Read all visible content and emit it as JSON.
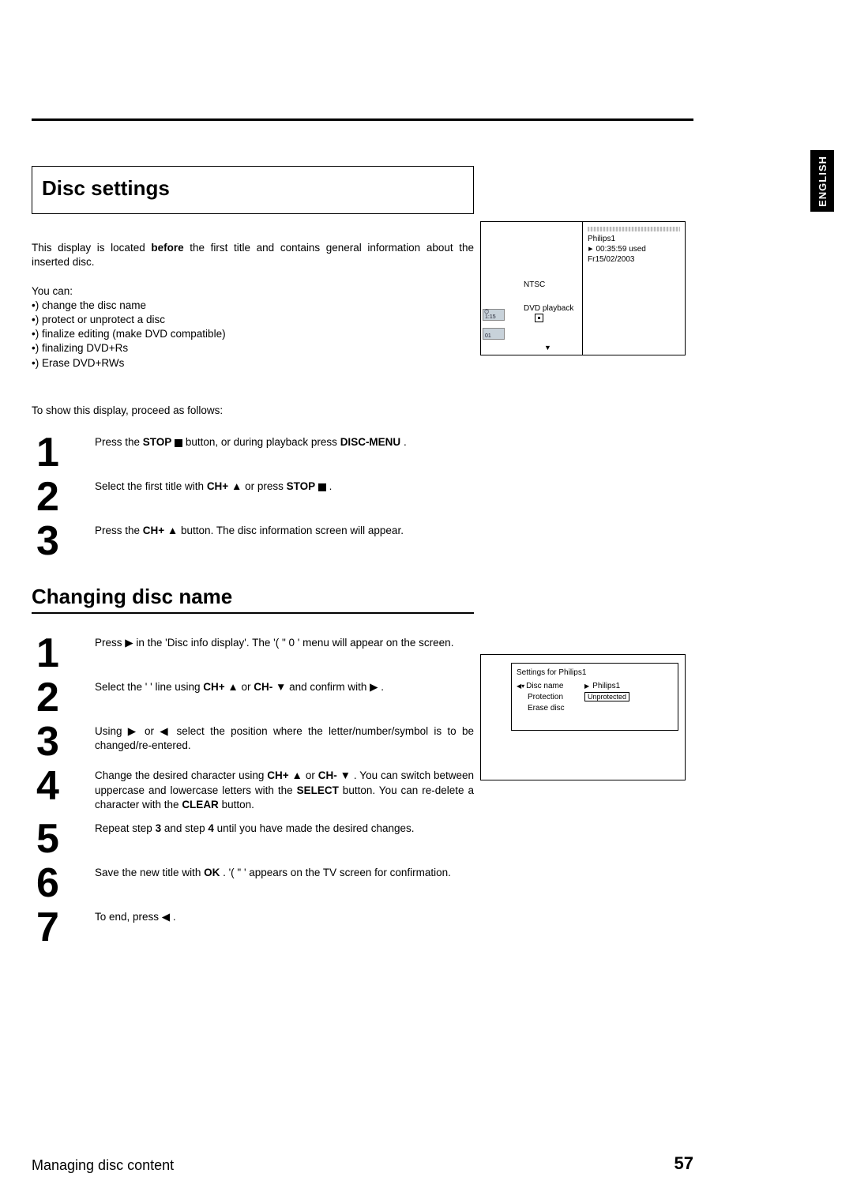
{
  "language_tab": "ENGLISH",
  "section_title": "Disc settings",
  "intro_a": "This display is located ",
  "intro_bold": "before",
  "intro_b": " the first title and contains general information about the inserted disc.",
  "youcan": "You can:",
  "bullets": [
    "•) change the disc name",
    "•) protect or unprotect a disc",
    "•) finalize editing (make DVD compatible)",
    "•) finalizing DVD+Rs",
    "•) Erase DVD+RWs"
  ],
  "proceed": "To show this display, proceed as follows:",
  "steps_a": [
    {
      "n": "1",
      "parts": [
        "Press the ",
        {
          "b": "STOP"
        },
        " ",
        {
          "stop": true
        },
        " button, or during playback press ",
        {
          "b": "DISC-MENU"
        },
        " ."
      ]
    },
    {
      "n": "2",
      "parts": [
        "Select the first title with ",
        {
          "b": "CH+"
        },
        " ▲ or press ",
        {
          "b": "STOP"
        },
        " ",
        {
          "stop": true
        },
        " ."
      ]
    },
    {
      "n": "3",
      "parts": [
        "Press the ",
        {
          "b": "CH+"
        },
        " ▲ button. The disc information screen will appear."
      ]
    }
  ],
  "section2_title": "Changing disc name",
  "steps_b": [
    {
      "n": "1",
      "parts": [
        "Press ▶ in the 'Disc info display'. The '(       \"    0   ' menu will appear on the screen."
      ]
    },
    {
      "n": "2",
      "parts": [
        "Select the '               ' line using ",
        {
          "b": "CH+"
        },
        " ▲ or ",
        {
          "b": "CH-"
        },
        " ▼ and confirm with ▶ ."
      ]
    },
    {
      "n": "3",
      "parts": [
        "Using   ▶ or   ◀ select the position where the letter/number/symbol is to be changed/re-entered."
      ]
    },
    {
      "n": "4",
      "parts": [
        "Change the desired character using ",
        {
          "b": "CH+"
        },
        " ▲ or ",
        {
          "b": "CH-"
        },
        " ▼ . You can switch between uppercase and lowercase letters with the ",
        {
          "b": "SELECT"
        },
        " button. You can re-delete a character with the ",
        {
          "b": "CLEAR"
        },
        " button."
      ]
    },
    {
      "n": "5",
      "parts": [
        "Repeat step ",
        {
          "b": "3"
        },
        " and step ",
        {
          "b": "4"
        },
        " until you have made the desired changes."
      ]
    },
    {
      "n": "6",
      "parts": [
        "Save the new title with ",
        {
          "b": "OK"
        },
        " . '(        \"         ' appears on the TV screen for confirmation."
      ]
    },
    {
      "n": "7",
      "parts": [
        "To end, press ◀ ."
      ]
    }
  ],
  "fig1": {
    "ntsc": "NTSC",
    "dvd_playback": "DVD playback",
    "tile1": "1:15",
    "tile2": "01",
    "disc_name": "Philips1",
    "used": "00:35:59 used",
    "date": "Fr15/02/2003"
  },
  "fig2": {
    "header": "Settings for Philips1",
    "rows": [
      {
        "label": "Disc name",
        "cursor": true,
        "arrow": true,
        "value": "Philips1",
        "boxed": false
      },
      {
        "label": "Protection",
        "cursor": false,
        "arrow": false,
        "value": "Unprotected",
        "boxed": true
      },
      {
        "label": "Erase disc",
        "cursor": false,
        "arrow": false,
        "value": "",
        "boxed": false
      }
    ]
  },
  "footer_left": "Managing disc content",
  "footer_page": "57"
}
